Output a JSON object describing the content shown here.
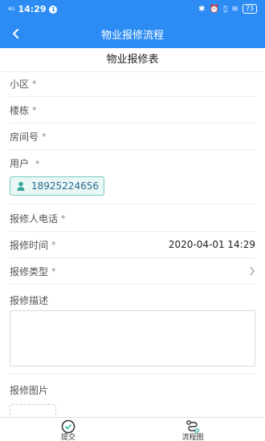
{
  "status_bar": {
    "signal": "4G",
    "time": "14:29",
    "notification_badge": "1",
    "battery": "73"
  },
  "header": {
    "title": "物业报修流程",
    "back_icon": "chevron-left-icon"
  },
  "form": {
    "title": "物业报修表",
    "fields": {
      "community": {
        "label": "小区",
        "required": "*"
      },
      "building": {
        "label": "楼栋",
        "required": "*"
      },
      "room": {
        "label": "房间号",
        "required": "*"
      },
      "user": {
        "label": "用户",
        "required": "*",
        "value": "18925224656"
      },
      "phone": {
        "label": "报修人电话",
        "required": "*"
      },
      "time": {
        "label": "报修时间",
        "required": "*",
        "value": "2020-04-01 14:29"
      },
      "type": {
        "label": "报修类型",
        "required": "*"
      },
      "description": {
        "label": "报修描述"
      },
      "photos": {
        "label": "报修图片"
      }
    }
  },
  "tabbar": {
    "submit": {
      "label": "提交",
      "icon": "check-circle-icon"
    },
    "flow": {
      "label": "流程图",
      "icon": "flow-icon"
    }
  },
  "colors": {
    "header_bg": "#2c8cf4",
    "chip_border": "#76c9be",
    "chip_bg": "#e9f7f5"
  }
}
